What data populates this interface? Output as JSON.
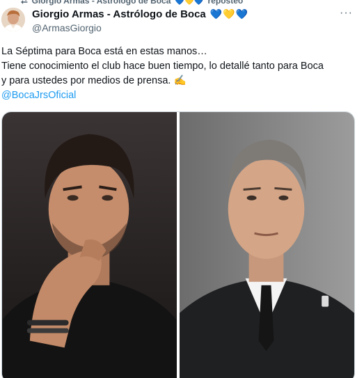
{
  "repost": {
    "icon": "repost-icon",
    "text": "Giorgio Armas - Astrólogo de Boca",
    "hearts": "💙💛💙",
    "suffix": "reposteó"
  },
  "author": {
    "name": "Giorgio Armas - Astrólogo de Boca",
    "hearts": "💙💛💙",
    "handle": "@ArmasGiorgio",
    "avatar_icon": "user-avatar"
  },
  "more_icon": "more-icon",
  "tweet": {
    "line1": "La Séptima para Boca está en estas manos…",
    "line2": "Tiene conocimiento el club hace buen tiempo, lo detallé tanto para Boca",
    "line3": "y para ustedes por medios de prensa. ✍️",
    "mention": "@BocaJrsOficial"
  },
  "media": {
    "photos": [
      "photo-man-hand-on-chin",
      "photo-man-suit-tie"
    ]
  },
  "colors": {
    "link": "#1d9bf0",
    "secondary_text": "#536471",
    "primary_text": "#0f1419"
  }
}
